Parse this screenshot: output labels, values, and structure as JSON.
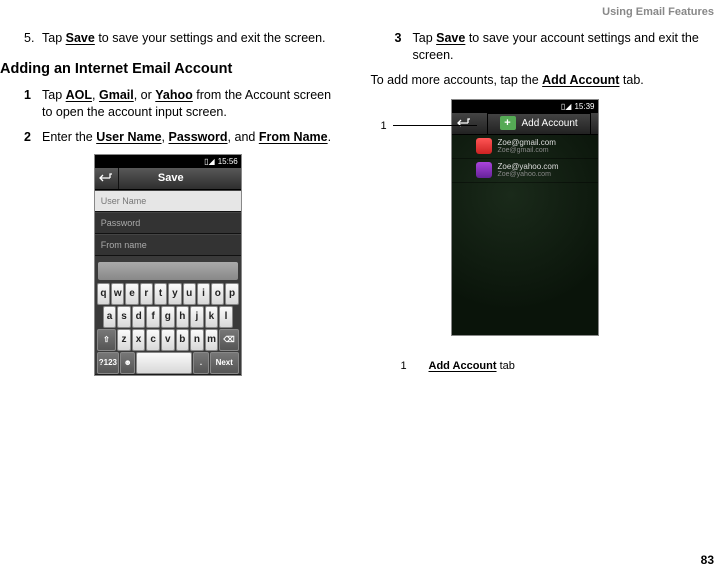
{
  "header": "Using Email Features",
  "page_number": "83",
  "left": {
    "step5_num": "5.",
    "step5_text_a": "Tap ",
    "step5_save": "Save",
    "step5_text_b": " to save your settings and exit the screen.",
    "heading": "Adding an Internet Email Account",
    "step1_num": "1",
    "step1_a": "Tap ",
    "step1_aol": "AOL",
    "step1_comma1": ", ",
    "step1_gmail": "Gmail",
    "step1_comma2": ", or ",
    "step1_yahoo": "Yahoo",
    "step1_b": " from the Account screen to open the account input screen.",
    "step2_num": "2",
    "step2_a": "Enter the ",
    "step2_user": "User Name",
    "step2_comma1": ", ",
    "step2_pass": "Password",
    "step2_comma2": ", and ",
    "step2_from": "From Name",
    "step2_b": "."
  },
  "right": {
    "step3_num": "3",
    "step3_a": "Tap ",
    "step3_save": "Save",
    "step3_b": " to save your account settings and exit the screen.",
    "para_a": "To add more accounts, tap the ",
    "para_add": "Add Account",
    "para_b": " tab.",
    "callout_num": "1",
    "legend_num": "1",
    "legend_label": "Add Account",
    "legend_suffix": " tab"
  },
  "phone1": {
    "time": "15:56",
    "save": "Save",
    "user": "User Name",
    "pass": "Password",
    "from": "From name",
    "row1": [
      "q",
      "w",
      "e",
      "r",
      "t",
      "y",
      "u",
      "i",
      "o",
      "p"
    ],
    "row2": [
      "a",
      "s",
      "d",
      "f",
      "g",
      "h",
      "j",
      "k",
      "l"
    ],
    "sym": "?123",
    "next": "Next"
  },
  "phone2": {
    "time": "15:39",
    "add": "Add Account",
    "acct1": "Zoe@gmail.com",
    "acct1sub": "Zoe@gmail.com",
    "acct2": "Zoe@yahoo.com",
    "acct2sub": "Zoe@yahoo.com"
  }
}
